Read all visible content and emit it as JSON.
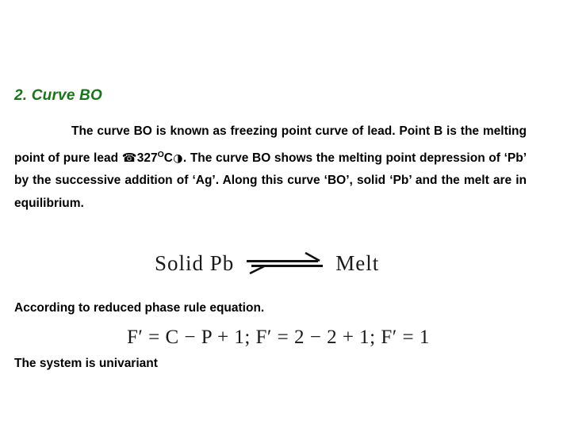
{
  "slide": {
    "background_color": "#ffffff",
    "heading": {
      "text": "2. Curve BO",
      "color": "#177717"
    },
    "paragraph": {
      "part1": "The curve BO is known as freezing point curve of lead. Point B is the melting point of pure lead ",
      "symbol_phone": "☎",
      "temperature": "327",
      "degree_superscript": "O",
      "unit": "C",
      "symbol_circle": "◑",
      "part2": ". The curve BO shows the melting point depression of ‘Pb’ by the successive addition of ‘Ag’. Along this curve ‘BO’, solid ‘Pb’ and the melt are in equilibrium."
    },
    "equilibrium_figure": {
      "left_term": "Solid  Pb",
      "arrow": "equilibrium-double-arrow",
      "right_term": "Melt"
    },
    "reduced_phase_rule_line": "According to reduced phase rule equation.",
    "formula": "F′ = C − P + 1; F′ = 2 − 2 + 1; F′ = 1",
    "conclusion": "The system is univariant"
  }
}
